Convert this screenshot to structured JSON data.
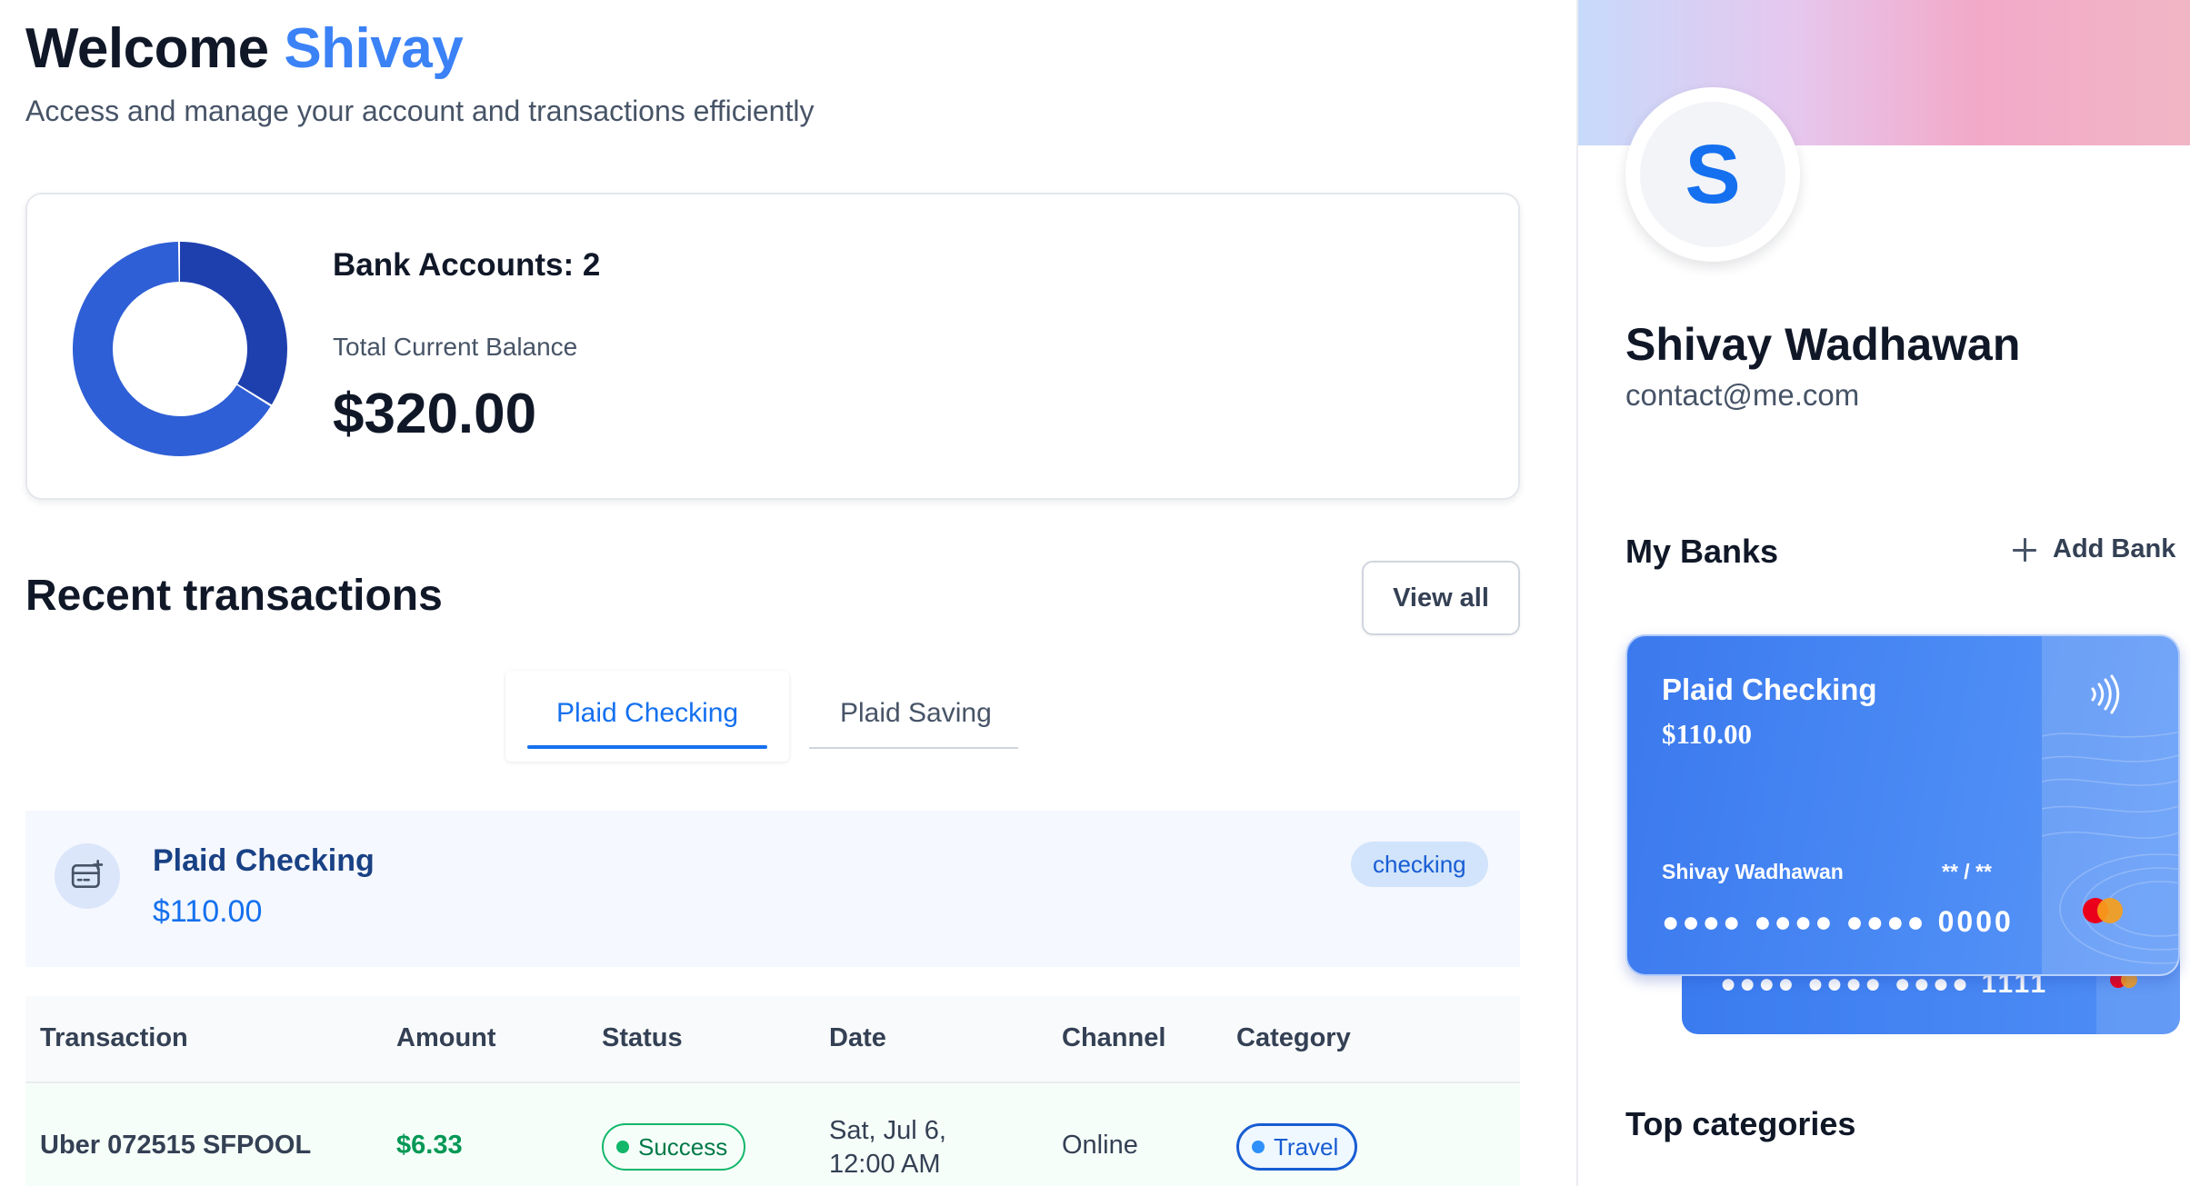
{
  "header": {
    "greeting": "Welcome",
    "user_first_name": "Shivay",
    "subtitle": "Access and manage your account and transactions efficiently"
  },
  "summary": {
    "bank_accounts_label": "Bank Accounts: 2",
    "total_balance_label": "Total Current Balance",
    "total_balance_value": "$320.00",
    "donut_shares": [
      0.34,
      0.66
    ],
    "donut_colors": [
      "#1e40af",
      "#2f5fd6"
    ]
  },
  "recent": {
    "title": "Recent transactions",
    "view_all_label": "View all",
    "tabs": [
      {
        "label": "Plaid Checking",
        "active": true
      },
      {
        "label": "Plaid Saving",
        "active": false
      }
    ],
    "account": {
      "name": "Plaid Checking",
      "balance": "$110.00",
      "type_badge": "checking"
    },
    "table": {
      "columns": [
        "Transaction",
        "Amount",
        "Status",
        "Date",
        "Channel",
        "Category"
      ],
      "rows": [
        {
          "transaction": "Uber 072515 SFPOOL",
          "amount": "$6.33",
          "status": "Success",
          "date": "Sat, Jul 6, 12:00 AM",
          "channel": "Online",
          "category": "Travel"
        }
      ]
    }
  },
  "profile": {
    "avatar_initial": "S",
    "name": "Shivay Wadhawan",
    "email": "contact@me.com"
  },
  "banks": {
    "title": "My Banks",
    "add_label": "Add Bank",
    "primary_card": {
      "name": "Plaid Checking",
      "balance": "$110.00",
      "holder": "Shivay Wadhawan",
      "expiry": "** / **",
      "number": "●●●● ●●●● ●●●● 0000"
    },
    "secondary_card": {
      "number": "●●●● ●●●● ●●●● 1111"
    }
  },
  "top_categories": {
    "title": "Top categories"
  },
  "colors": {
    "accent": "#1570ef",
    "success": "#12b76a",
    "card": "#4a8af4"
  }
}
